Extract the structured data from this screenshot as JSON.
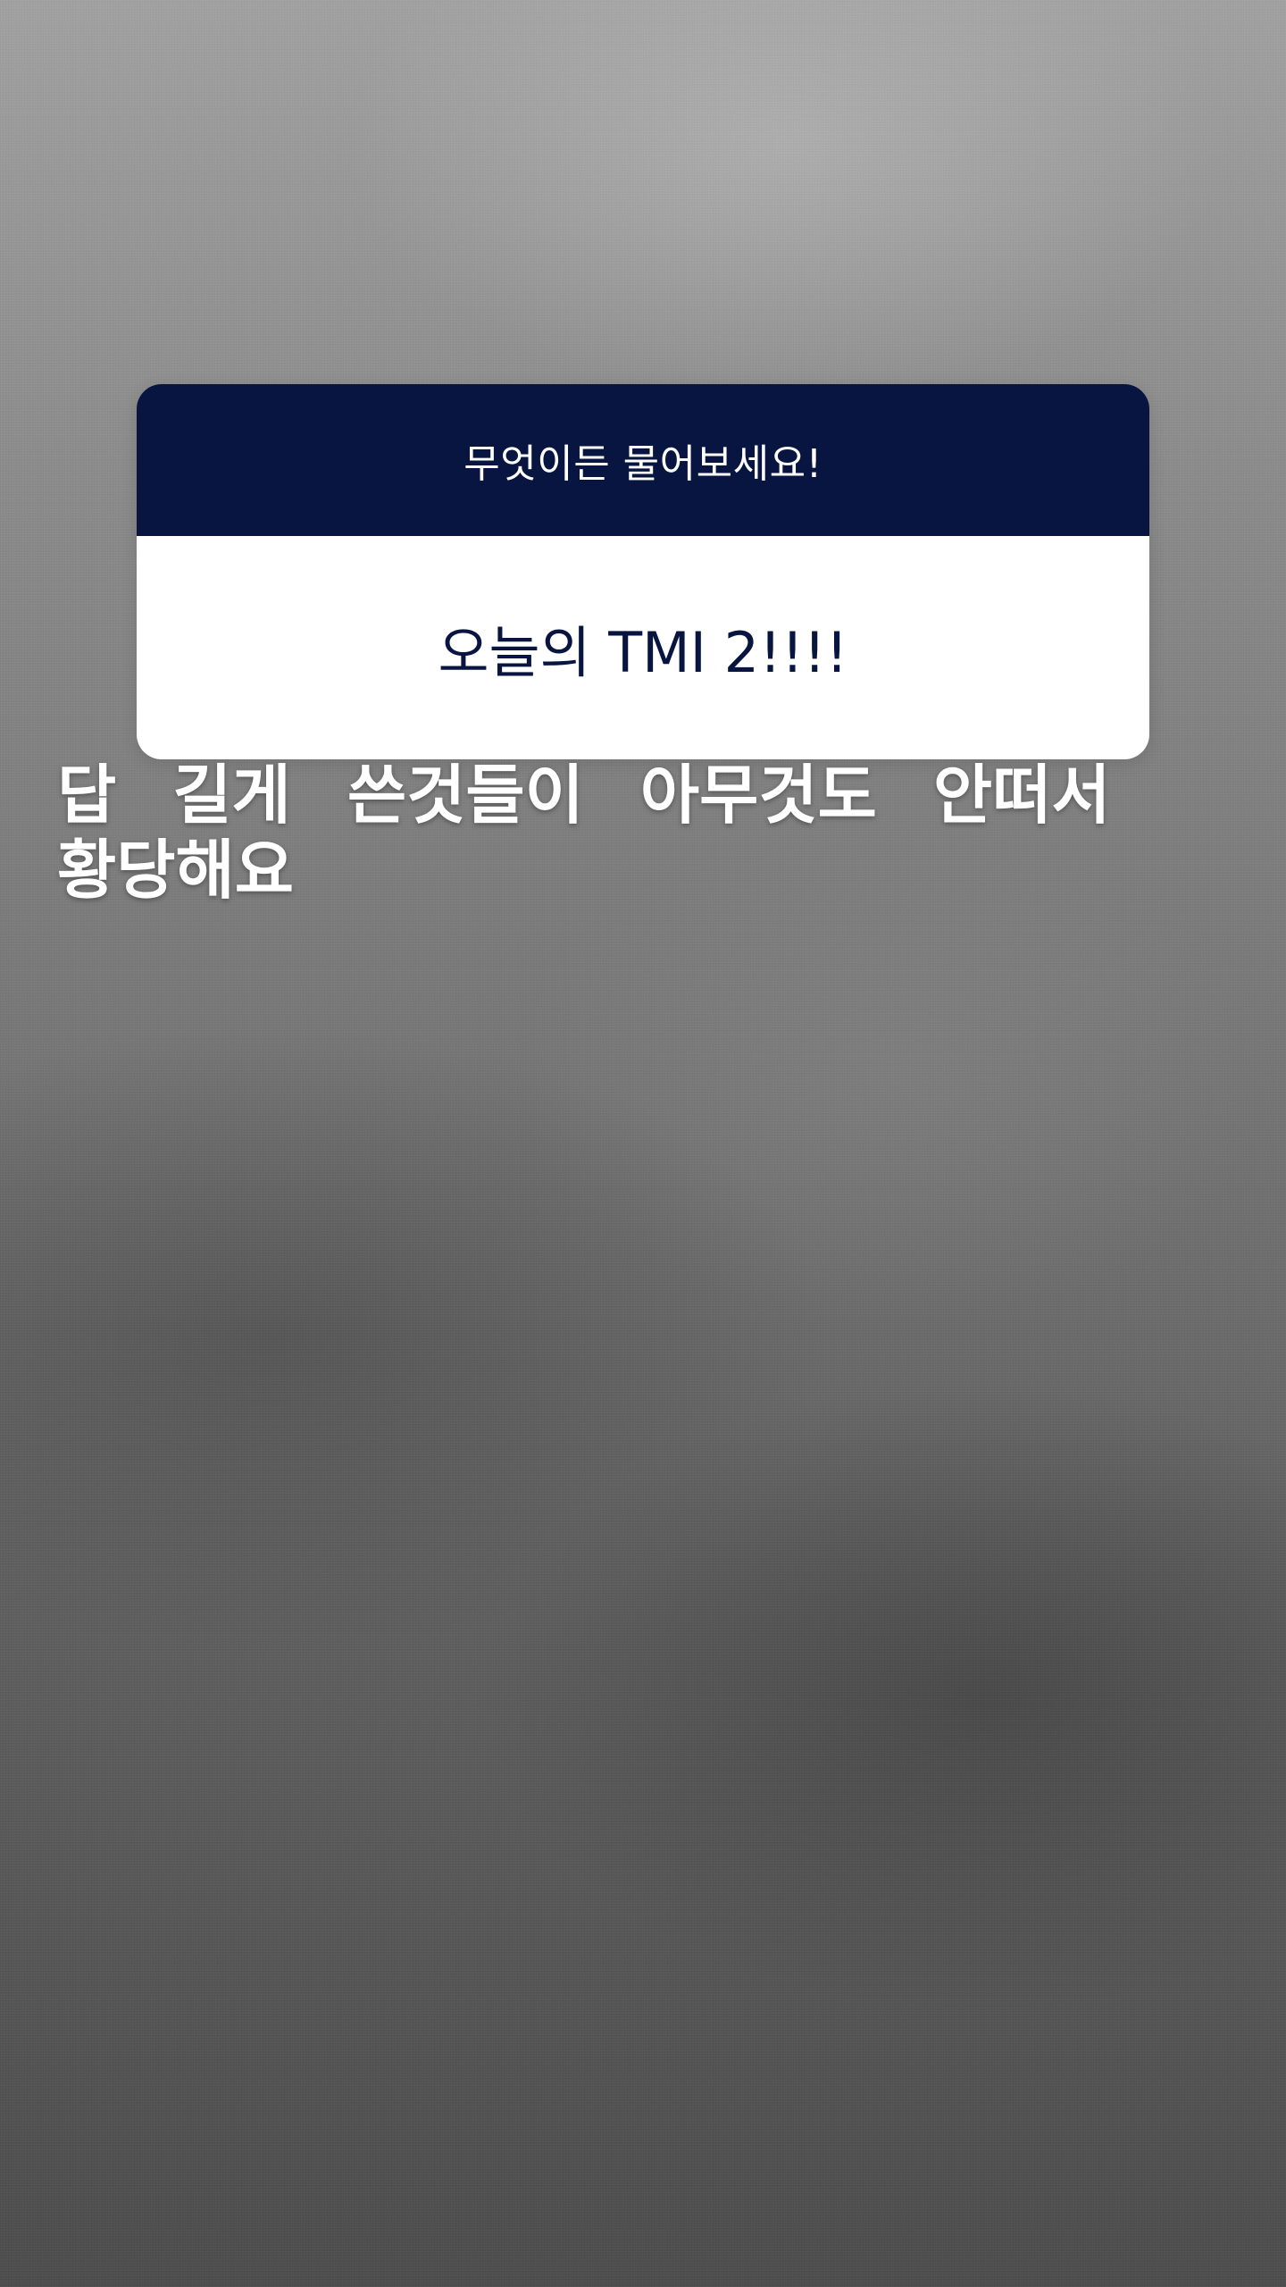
{
  "question_sticker": {
    "prompt": "무엇이든 물어보세요!",
    "question": "오늘의 TMI 2!!!!",
    "header_color": "#071540",
    "body_color": "#ffffff"
  },
  "answer": {
    "line1": "답 길게 쓴것들이 아무것도 안떠서",
    "line2": "황당해요"
  }
}
